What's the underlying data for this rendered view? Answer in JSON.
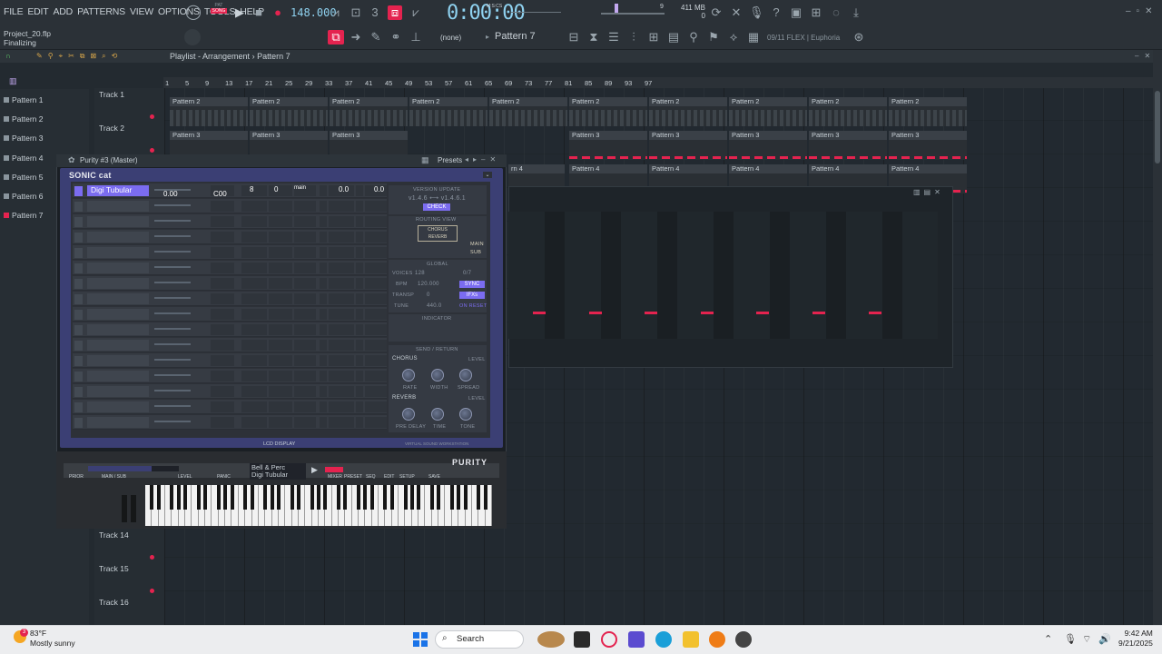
{
  "menu": [
    "FILE",
    "EDIT",
    "ADD",
    "PATTERNS",
    "VIEW",
    "OPTIONS",
    "TOOLS",
    "HELP"
  ],
  "transport": {
    "tempo": "148.000",
    "time": "0:00:00",
    "time_unit": "M:S:CS",
    "pat_label": "PAT",
    "song_label": "SONG"
  },
  "memory": {
    "mb": "411 MB",
    "cpu": "0",
    "voices": "9"
  },
  "project": {
    "file": "Project_20.flp",
    "status": "Finalizing"
  },
  "toolbar": {
    "none_label": "(none)",
    "pattern": "Pattern 7",
    "flex": "09/11 FLEX | Euphoria"
  },
  "playlist": {
    "title": "Playlist - Arrangement",
    "sep": "›",
    "pattern": "Pattern 7",
    "patterns": [
      "Pattern 1",
      "Pattern 2",
      "Pattern 3",
      "Pattern 4",
      "Pattern 5",
      "Pattern 6",
      "Pattern 7"
    ],
    "tracks": [
      "Track 1",
      "Track 2",
      "Track 14",
      "Track 15",
      "Track 16"
    ],
    "ruler": [
      "1",
      "5",
      "9",
      "13",
      "17",
      "21",
      "25",
      "29",
      "33",
      "37",
      "41",
      "45",
      "49",
      "53",
      "57",
      "61",
      "65",
      "69",
      "73",
      "77",
      "81",
      "85",
      "89",
      "93",
      "97"
    ],
    "clip_labels": {
      "t1": "Pattern 2",
      "t2": "Pattern 3",
      "t3": "Pattern 4",
      "t3_cut": "rn 4"
    }
  },
  "purity": {
    "window_title": "Purity #3 (Master)",
    "presets_label": "Presets",
    "brand": "SONIC cat",
    "row1": {
      "name": "Digi Tubular",
      "level": "0.00",
      "pan": "C00",
      "voices": "8",
      "transp": "0",
      "out": "main",
      "chorus": "0.0",
      "reverb": "0.0"
    },
    "update": {
      "title": "VERSION UPDATE",
      "versions": "v1.4.6 ⟷ v1.4.6.1",
      "check": "CHECK"
    },
    "routing": {
      "title": "ROUTING VIEW",
      "chorus": "CHORUS",
      "reverb": "REVERB",
      "main": "MAIN",
      "sub": "SUB"
    },
    "global": {
      "title": "GLOBAL",
      "voices": "VOICES",
      "voices_val": "128",
      "bpm": "BPM",
      "bpm_val": "120.000",
      "sync": "SYNC",
      "transp": "TRANSP",
      "transp_val": "0",
      "ifx": "IFXs",
      "tune": "TUNE",
      "tune_val": "440.0",
      "on_reset": "ON RESET",
      "count": "0/7"
    },
    "indicator": "INDICATOR",
    "send": {
      "title": "SEND / RETURN",
      "chorus": "CHORUS",
      "reverb": "REVERB",
      "level": "LEVEL",
      "rate": "RATE",
      "width": "WIDTH",
      "spread": "SPREAD",
      "predelay": "PRE DELAY",
      "time": "TIME",
      "tone": "TONE"
    },
    "lcd": "LCD DISPLAY",
    "footer": "VIRTUAL SOUND WORKSTATION",
    "keyboard": {
      "logo": "PURITY",
      "category": "Bell & Perc",
      "preset": "Digi Tubular",
      "prior": "PRIOR",
      "main_sub": "MAIN / SUB",
      "level": "LEVEL",
      "panic": "PANIC",
      "mixer": "MIXER",
      "preset_lbl": "PRESET",
      "seq": "SEQ",
      "edit": "EDIT",
      "setup": "SETUP",
      "save": "SAVE"
    }
  },
  "taskbar": {
    "weather_temp": "83°F",
    "weather_desc": "Mostly sunny",
    "search": "Search",
    "time": "9:42 AM",
    "date": "9/21/2025",
    "notif": "3"
  },
  "colors": {
    "accent": "#e4234f",
    "lcd": "#8fd2f0",
    "purity": "#7b6cf0"
  }
}
